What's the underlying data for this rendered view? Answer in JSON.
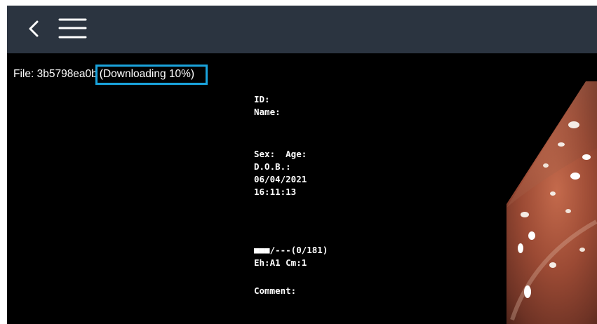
{
  "toolbar": {
    "back_icon": "chevron-left-icon",
    "menu_icon": "hamburger-menu-icon",
    "background_color": "#2b3440"
  },
  "file": {
    "label": "File: 3b5798ea0b",
    "status": "(Downloading 10%)",
    "download_progress_percent": 10,
    "status_border_color": "#1aa3dc"
  },
  "patient": {
    "id_label": "ID:",
    "name_label": "Name:",
    "sex_age_label": "Sex:  Age:",
    "dob_label": "D.O.B.:",
    "date": "06/04/2021",
    "time": "16:11:13"
  },
  "image_info": {
    "counter": "■■■/---(0/181)",
    "eh_cm": "Eh:A1 Cm:1",
    "comment_label": "Comment:"
  }
}
